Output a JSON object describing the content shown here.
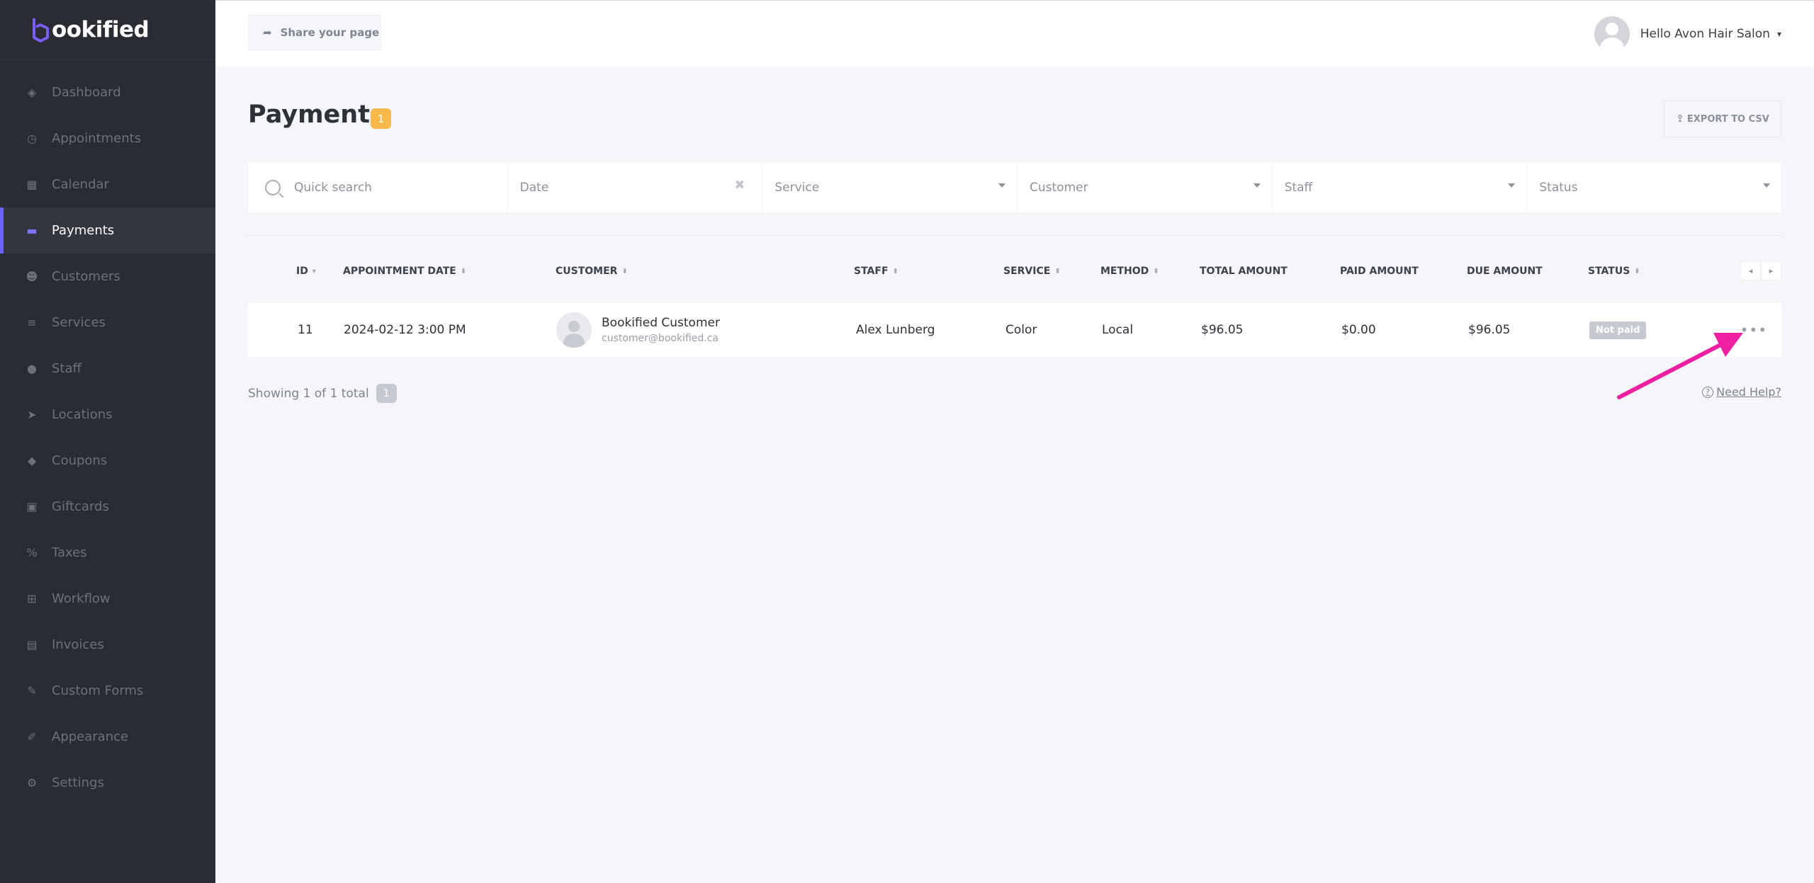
{
  "brand": {
    "logo_text": "ookified",
    "logo_letter": "b"
  },
  "sidebar": {
    "items": [
      {
        "label": "Dashboard",
        "icon": "dashboard-icon",
        "glyph": "◈"
      },
      {
        "label": "Appointments",
        "icon": "clock-icon",
        "glyph": "◷"
      },
      {
        "label": "Calendar",
        "icon": "calendar-icon",
        "glyph": "▦"
      },
      {
        "label": "Payments",
        "icon": "wallet-icon",
        "glyph": "▬",
        "active": true
      },
      {
        "label": "Customers",
        "icon": "users-icon",
        "glyph": "☻"
      },
      {
        "label": "Services",
        "icon": "list-icon",
        "glyph": "≡"
      },
      {
        "label": "Staff",
        "icon": "user-icon",
        "glyph": "●"
      },
      {
        "label": "Locations",
        "icon": "location-arrow-icon",
        "glyph": "➤"
      },
      {
        "label": "Coupons",
        "icon": "tag-icon",
        "glyph": "◆"
      },
      {
        "label": "Giftcards",
        "icon": "gift-icon",
        "glyph": "▣"
      },
      {
        "label": "Taxes",
        "icon": "percent-icon",
        "glyph": "%"
      },
      {
        "label": "Workflow",
        "icon": "sitemap-icon",
        "glyph": "⊞"
      },
      {
        "label": "Invoices",
        "icon": "file-icon",
        "glyph": "▤"
      },
      {
        "label": "Custom Forms",
        "icon": "magic-wand-icon",
        "glyph": "✎"
      },
      {
        "label": "Appearance",
        "icon": "brush-icon",
        "glyph": "✐"
      },
      {
        "label": "Settings",
        "icon": "gear-icon",
        "glyph": "⚙"
      }
    ]
  },
  "topbar": {
    "share_label": "Share your page",
    "user_greeting": "Hello Avon Hair Salon"
  },
  "page": {
    "title": "Payments",
    "count_badge": "1",
    "export_label": "EXPORT TO CSV"
  },
  "filters": {
    "search_placeholder": "Quick search",
    "date": "Date",
    "service": "Service",
    "customer": "Customer",
    "staff": "Staff",
    "status": "Status"
  },
  "table": {
    "headers": {
      "id": "ID",
      "appointment_date": "APPOINTMENT DATE",
      "customer": "CUSTOMER",
      "staff": "STAFF",
      "service": "SERVICE",
      "method": "METHOD",
      "total_amount": "TOTAL AMOUNT",
      "paid_amount": "PAID AMOUNT",
      "due_amount": "DUE AMOUNT",
      "status": "STATUS"
    },
    "rows": [
      {
        "id": "11",
        "appointment_date": "2024-02-12 3:00 PM",
        "customer_name": "Bookified Customer",
        "customer_email": "customer@bookified.ca",
        "staff": "Alex Lunberg",
        "service": "Color",
        "method": "Local",
        "total_amount": "$96.05",
        "paid_amount": "$0.00",
        "due_amount": "$96.05",
        "status": "Not paid"
      }
    ]
  },
  "footer": {
    "showing": "Showing 1 of 1 total",
    "total_badge": "1",
    "help_label": "Need Help?"
  },
  "colors": {
    "accent": "#6c63ff",
    "badge_yellow": "#f6b94a",
    "annotation_arrow": "#ee1fa0",
    "sidebar_bg": "#292c33"
  }
}
